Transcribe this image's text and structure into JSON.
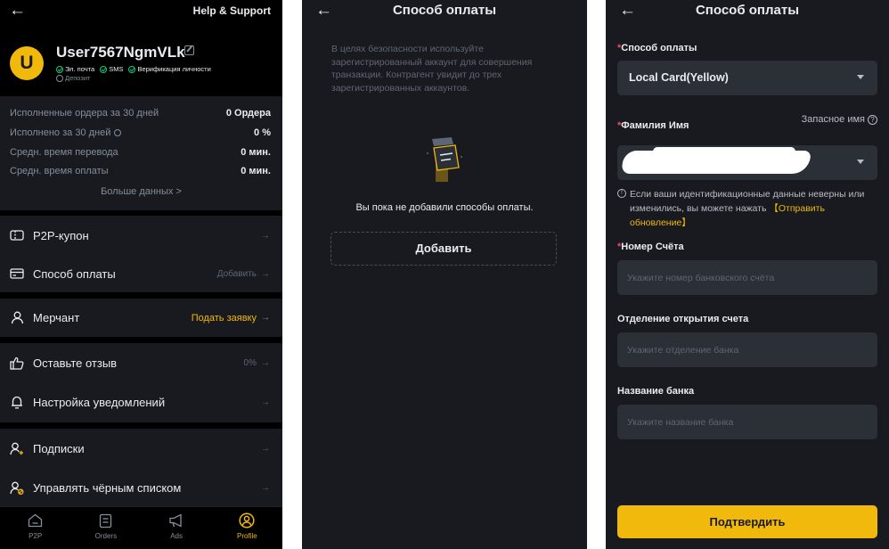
{
  "panel1": {
    "help_label": "Help & Support",
    "avatar_letter": "U",
    "username": "User7567NgmVLk",
    "verifications": [
      "Эл. почта",
      "SMS",
      "Верификация личности"
    ],
    "deposit_label": "Депозит",
    "stats": [
      {
        "label": "Исполненные ордера за 30 дней",
        "value": "0 Ордера"
      },
      {
        "label": "Исполнено за 30 дней",
        "value": "0 %"
      },
      {
        "label": "Средн. время перевода",
        "value": "0 мин."
      },
      {
        "label": "Средн. время оплаты",
        "value": "0 мин."
      }
    ],
    "more_data": "Больше данных >",
    "menu": [
      {
        "label": "P2P-купон",
        "right": "",
        "icon": "coupon-icon"
      },
      {
        "label": "Способ оплаты",
        "right": "Добавить",
        "icon": "card-icon"
      },
      {
        "label": "Мерчант",
        "right": "Подать заявку",
        "icon": "merchant-icon"
      },
      {
        "label": "Оставьте отзыв",
        "right": "0%",
        "icon": "thumbs-up-icon"
      },
      {
        "label": "Настройка уведомлений",
        "right": "",
        "icon": "bell-icon"
      },
      {
        "label": "Подписки",
        "right": "",
        "icon": "user-plus-icon"
      },
      {
        "label": "Управлять чёрным списком",
        "right": "",
        "icon": "user-block-icon"
      }
    ],
    "tabs": [
      {
        "label": "P2P",
        "icon": "home-icon"
      },
      {
        "label": "Orders",
        "icon": "orders-icon"
      },
      {
        "label": "Ads",
        "icon": "megaphone-icon"
      },
      {
        "label": "Profile",
        "icon": "profile-icon"
      }
    ],
    "active_tab": "Profile",
    "accent_color": "#f0b90b"
  },
  "panel2": {
    "title": "Способ оплаты",
    "notice": "В целях безопасности используйте зарегистрированный аккаунт для совершения транзакции. Контрагент увидит до трех зарегистрированных аккаунтов.",
    "empty_text": "Вы пока не добавили способы оплаты.",
    "add_label": "Добавить"
  },
  "panel3": {
    "title": "Способ оплаты",
    "method_label": "Способ оплаты",
    "method_value": "Local Card(Yellow)",
    "name_label": "Фамилия Имя",
    "alt_name_label": "Запасное имя",
    "hint_text": "Если ваши идентификационные данные неверны или изменились, вы можете нажать ",
    "hint_link": "【Отправить обновление】",
    "account_label": "Номер Счёта",
    "account_placeholder": "Укажите номер банковского счёта",
    "branch_label": "Отделение открытия счета",
    "branch_placeholder": "Укажите отделение банка",
    "bank_label": "Название банка",
    "bank_placeholder": "Укажите название банка",
    "confirm_label": "Подтвердить"
  }
}
